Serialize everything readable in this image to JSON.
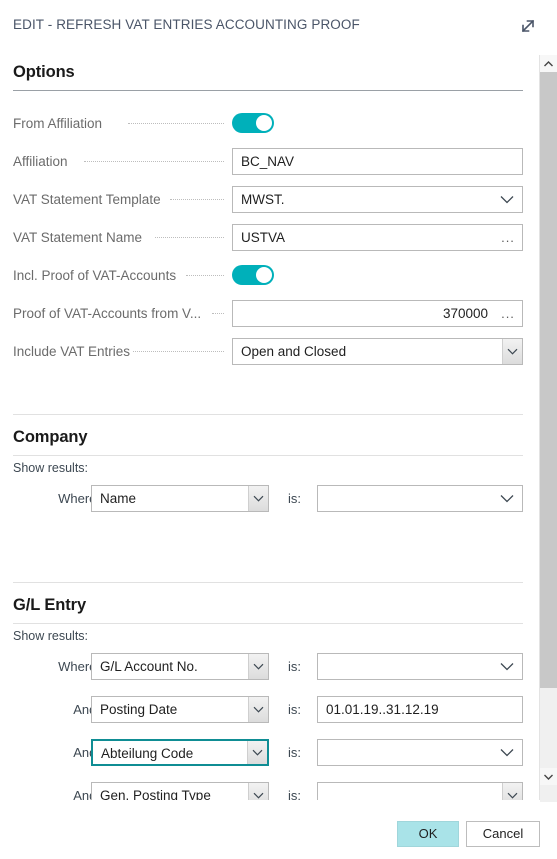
{
  "dialog": {
    "title": "EDIT - REFRESH VAT ENTRIES ACCOUNTING PROOF",
    "expand_icon": "expand-diagonal-icon"
  },
  "accent_color": "#00b0ba",
  "sections": {
    "options": {
      "heading": "Options",
      "rows": [
        {
          "label": "From Affiliation",
          "type": "toggle",
          "value": "on"
        },
        {
          "label": "Affiliation",
          "type": "text",
          "value": "BC_NAV"
        },
        {
          "label": "VAT Statement Template",
          "type": "dropdown",
          "value": "MWST."
        },
        {
          "label": "VAT Statement Name",
          "type": "lookup",
          "value": "USTVA",
          "button": "..."
        },
        {
          "label": "Incl. Proof of VAT-Accounts",
          "type": "toggle",
          "value": "on"
        },
        {
          "label": "Proof of VAT-Accounts from V...",
          "type": "lookup-number",
          "value": "370000",
          "button": "..."
        },
        {
          "label": "Include VAT Entries",
          "type": "select",
          "value": "Open and Closed"
        }
      ]
    },
    "company": {
      "heading": "Company",
      "show_results_label": "Show results:",
      "filters": [
        {
          "conj": "Where:",
          "field": "Name",
          "is_label": "is:",
          "value": ""
        }
      ]
    },
    "gl_entry": {
      "heading": "G/L Entry",
      "show_results_label": "Show results:",
      "filters": [
        {
          "conj": "Where:",
          "field": "G/L Account No.",
          "is_label": "is:",
          "value": ""
        },
        {
          "conj": "And:",
          "field": "Posting Date",
          "is_label": "is:",
          "value": "01.01.19..31.12.19"
        },
        {
          "conj": "And:",
          "field": "Abteilung Code",
          "is_label": "is:",
          "value": "",
          "focused": true
        },
        {
          "conj": "And:",
          "field": "Gen. Posting Type",
          "is_label": "is:",
          "value": ""
        }
      ]
    }
  },
  "footer": {
    "ok_label": "OK",
    "cancel_label": "Cancel"
  },
  "scrollbar": {
    "up_arrow_icon": "chevron-up-icon",
    "down_arrow_icon": "chevron-down-icon"
  }
}
